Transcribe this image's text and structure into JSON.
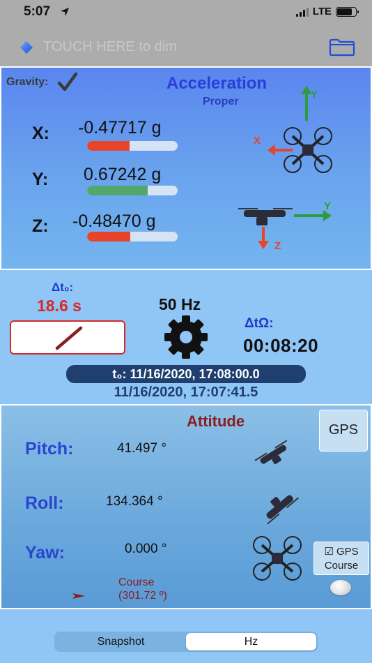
{
  "status_bar": {
    "time": "5:07",
    "network": "LTE"
  },
  "dim_bar": {
    "text": "TOUCH HERE to dim"
  },
  "acceleration": {
    "gravity_label": "Gravity:",
    "title": "Acceleration",
    "subtitle": "Proper",
    "axes": [
      {
        "label": "X:",
        "value": "-0.47717 g",
        "fraction": 0.47,
        "color": "#e8432b"
      },
      {
        "label": "Y:",
        "value": "0.67242 g",
        "fraction": 0.67,
        "color": "#52a86c"
      },
      {
        "label": "Z:",
        "value": "-0.48470 g",
        "fraction": 0.48,
        "color": "#e8432b"
      }
    ],
    "diagram_labels": {
      "top_y": "Y",
      "top_x": "X",
      "side_y": "Y",
      "side_z": "Z"
    },
    "colors": {
      "green_arrow": "#2e9c3a",
      "red_arrow": "#e8432b"
    }
  },
  "timing": {
    "delta_t0_label": "Δt₀:",
    "delta_t0_value": "18.6 s",
    "rate": "50 Hz",
    "delta_tomega_label": "ΔtΩ:",
    "delta_tomega_value": "00:08:20",
    "t0": "t₀: 11/16/2020, 17:08:00.0",
    "now": "11/16/2020, 17:07:41.5"
  },
  "attitude": {
    "title": "Attitude",
    "gps_button": "GPS",
    "rows": [
      {
        "label": "Pitch:",
        "value": "41.497 °"
      },
      {
        "label": "Roll:",
        "value": "134.364 °"
      },
      {
        "label": "Yaw:",
        "value": "0.000 °"
      }
    ],
    "gps_course_line1": "☑ GPS",
    "gps_course_line2": "Course",
    "course_label": "Course",
    "course_value": "(301.72 º)"
  },
  "segmented": {
    "options": [
      "Snapshot",
      "Hz"
    ],
    "selected": "Hz"
  }
}
